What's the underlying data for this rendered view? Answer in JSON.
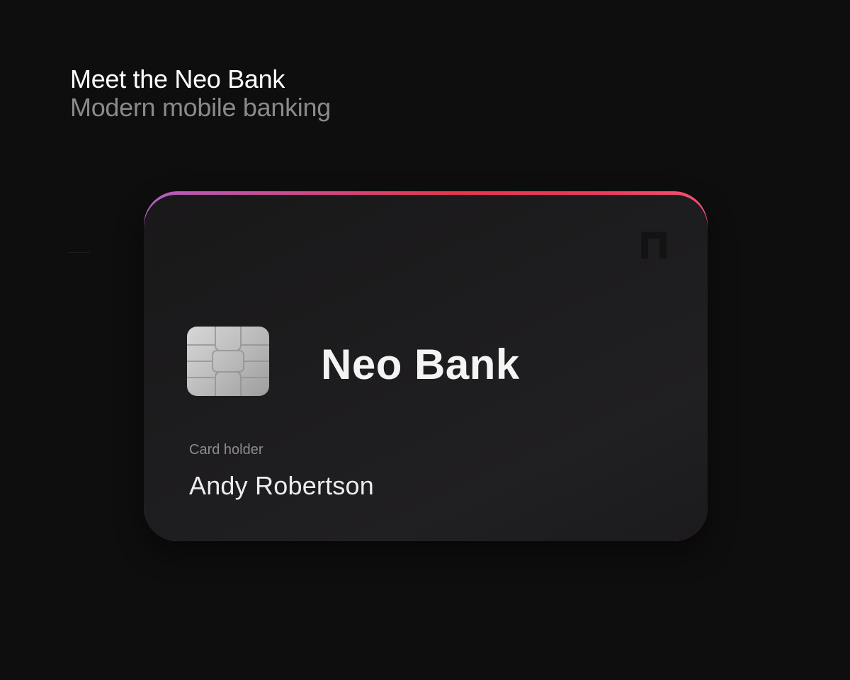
{
  "header": {
    "title": "Meet the Neo Bank",
    "subtitle": "Modern mobile banking"
  },
  "card": {
    "bank_name": "Neo Bank",
    "holder_label": "Card holder",
    "holder_name": "Andy Robertson",
    "brand_icon": "neo-logo-icon",
    "chip_icon": "emv-chip-icon"
  },
  "colors": {
    "background": "#0f0e0f",
    "card_surface": "#1d1c1e",
    "accent_gradient": [
      "#b25ec2",
      "#e8364f",
      "#f45274"
    ]
  }
}
